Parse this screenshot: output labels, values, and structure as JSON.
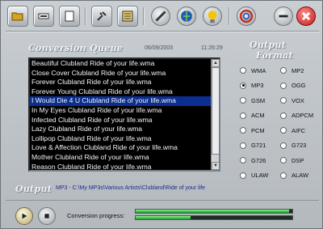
{
  "toolbar": {
    "buttons": [
      {
        "name": "open-folder-icon",
        "color": "#d6a31e"
      },
      {
        "name": "equalizer-icon",
        "color": "#333"
      },
      {
        "name": "document-icon",
        "color": "#fff"
      },
      {
        "name": "tools-icon",
        "color": "#333"
      },
      {
        "name": "list-icon",
        "color": "#2a2a2a"
      },
      {
        "name": "pen-icon",
        "color": "#333"
      },
      {
        "name": "globe-icon",
        "color": "#1c59b0"
      },
      {
        "name": "lightbulb-icon",
        "color": "#f1c40f"
      },
      {
        "name": "rings-icon",
        "color": "#c0392b"
      }
    ]
  },
  "queue": {
    "title": "Conversion Queue",
    "date": "06/09/2003",
    "time": "11:26:29",
    "items": [
      "Beautiful Clubland Ride of your life.wma",
      "Close Cover Clubland Ride of your life.wma",
      "Forever Clubland Ride of your life.wma",
      "Forever Young Clubland Ride of your life.wma",
      "I Would Die 4 U Clubland Ride of your life.wma",
      "In My Eyes Clubland Ride of your life.wma",
      "Infected Clubland Ride of your life.wma",
      "Lazy Clubland Ride of your life.wma",
      "Lollipop Clubland Ride of your life.wma",
      "Love & Affection Clubland Ride of your life.wma",
      "Mother Clubland Ride of your life.wma",
      "Reason Clubland Ride of your life.wma"
    ],
    "selected_index": 4
  },
  "output_format": {
    "title_line1": "Output",
    "title_line2": "Format",
    "options": [
      {
        "label": "WMA",
        "selected": false
      },
      {
        "label": "MP2",
        "selected": false
      },
      {
        "label": "MP3",
        "selected": true
      },
      {
        "label": "OGG",
        "selected": false
      },
      {
        "label": "GSM",
        "selected": false
      },
      {
        "label": "VOX",
        "selected": false
      },
      {
        "label": "ACM",
        "selected": false
      },
      {
        "label": "ADPCM",
        "selected": false
      },
      {
        "label": "PCM",
        "selected": false
      },
      {
        "label": "AIFC",
        "selected": false
      },
      {
        "label": "G721",
        "selected": false
      },
      {
        "label": "G723",
        "selected": false
      },
      {
        "label": "G726",
        "selected": false
      },
      {
        "label": "DSP",
        "selected": false
      },
      {
        "label": "ULAW",
        "selected": false
      },
      {
        "label": "ALAW",
        "selected": false
      }
    ]
  },
  "output": {
    "label": "Output",
    "path": "MP3  -  C:\\My MP3s\\Various Artists\\Clubland\\Ride of your life"
  },
  "progress": {
    "label": "Conversion progress:",
    "file_fraction": 0.98,
    "total_fraction": 0.35
  }
}
